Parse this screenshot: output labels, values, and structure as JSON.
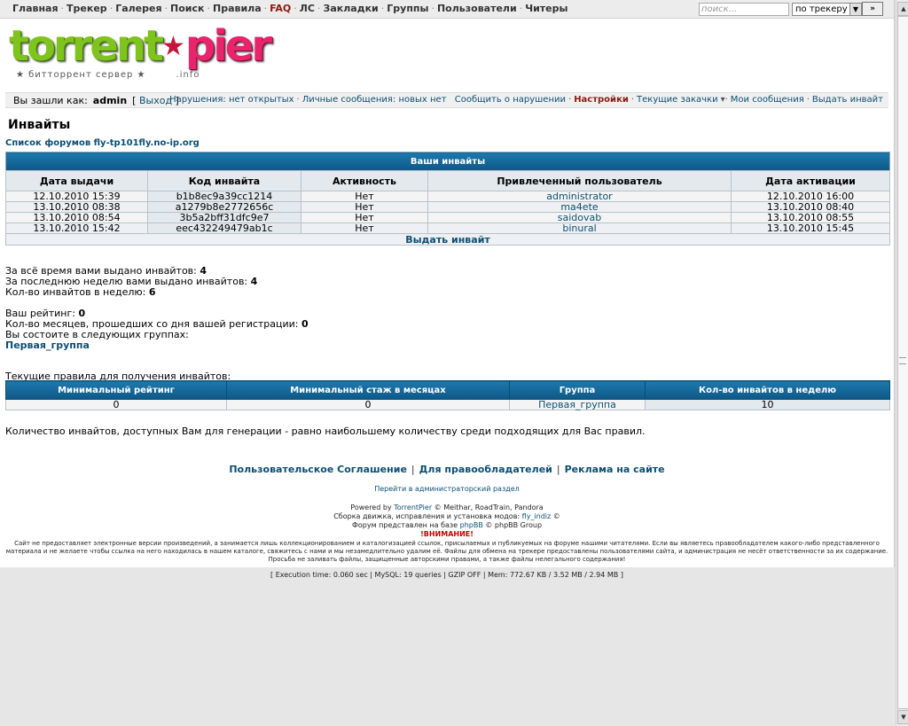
{
  "nav": {
    "items": [
      "Главная",
      "Трекер",
      "Галерея",
      "Поиск",
      "Правила",
      "FAQ",
      "ЛС",
      "Закладки",
      "Группы",
      "Пользователи",
      "Читеры"
    ],
    "search_placeholder": "поиск...",
    "search_scope": "по трекеру",
    "go_label": "»"
  },
  "logo": {
    "part1": "torrent",
    "part2": "pier",
    "tagline": "★ битторрент сервер ★",
    "domain": ".info"
  },
  "userbar": {
    "logged_as": "Вы зашли как:",
    "username": "admin",
    "logout": "Выход",
    "violations": "Нарушения: нет открытых",
    "pm": "Личные сообщения: новых нет",
    "report": "Сообщить о нарушении",
    "settings": "Настройки",
    "downloads": "Текущие закачки",
    "my_posts": "Мои сообщения",
    "give_invite": "Выдать инвайт"
  },
  "page": {
    "title": "Инвайты",
    "forum_list": "Список форумов fly-tp101fly.no-ip.org"
  },
  "invites": {
    "caption": "Ваши инвайты",
    "headers": [
      "Дата выдачи",
      "Код инвайта",
      "Активность",
      "Привлеченный пользователь",
      "Дата активации"
    ],
    "rows": [
      [
        "12.10.2010 15:39",
        "b1b8ec9a39cc1214",
        "Нет",
        "administrator",
        "12.10.2010 16:00"
      ],
      [
        "13.10.2010 08:38",
        "a1279b8e2772656c",
        "Нет",
        "ma4ete",
        "13.10.2010 08:40"
      ],
      [
        "13.10.2010 08:54",
        "3b5a2bff31dfc9e7",
        "Нет",
        "saidovab",
        "13.10.2010 08:55"
      ],
      [
        "13.10.2010 15:42",
        "eec432249479ab1c",
        "Нет",
        "binural",
        "13.10.2010 15:45"
      ]
    ],
    "give_link": "Выдать инвайт"
  },
  "stats": {
    "total_label": "За всё время вами выдано инвайтов:",
    "total": "4",
    "week_label": "За последнюю неделю вами выдано инвайтов:",
    "week": "4",
    "per_week_label": "Кол-во инвайтов в неделю:",
    "per_week": "6",
    "rating_label": "Ваш рейтинг:",
    "rating": "0",
    "months_label": "Кол-во месяцев, прошедших со дня вашей регистрации:",
    "months": "0",
    "groups_label": "Вы состоите в следующих группах:",
    "group": "Первая_группа"
  },
  "rules": {
    "title": "Текущие правила для получения инвайтов:",
    "headers": [
      "Минимальный рейтинг",
      "Минимальный стаж в месяцах",
      "Группа",
      "Кол-во инвайтов в неделю"
    ],
    "row": [
      "0",
      "0",
      "Первая_группа",
      "10"
    ],
    "note": "Количество инвайтов, доступных Вам для генерации - равно наибольшему количеству среди подходящих для Вас правил."
  },
  "footer": {
    "links": [
      "Пользовательское Соглашение",
      "Для правообладателей",
      "Реклама на сайте"
    ],
    "admin": "Перейти в администраторский раздел",
    "powered_1": "Powered by",
    "powered_tp": "TorrentPier",
    "powered_2": "© Meithar, RoadTrain, Pandora",
    "build_1": "Сборка движка, исправления и установка модов:",
    "build_author": "fly_indiz",
    "build_2": "©",
    "forum_1": "Форум представлен на базе",
    "forum_phpbb": "phpBB",
    "forum_2": "© phpBB Group",
    "warning": "!ВНИМАНИЕ!",
    "disclaimer": "Сайт не предоставляет электронные версии произведений, а занимается лишь коллекционированием и каталогизацией ссылок, присылаемых и публикуемых на форуме нашими читателями. Если вы являетесь правообладателем какого-либо представленного материала и не желаете чтобы ссылка на него находилась в нашем каталоге, свяжитесь с нами и мы незамедлительно удалим её. Файлы для обмена на трекере предоставлены пользователями сайта, и администрация не несёт ответственности за их содержание. Просьба не заливать файлы, защищенные авторскими правами, а также файлы нелегального содержания!",
    "exec": "[  Execution time: 0.060 sec  |  MySQL: 19 queries  |  GZIP OFF  |  Mem: 772.67 KB / 3.52 MB / 2.94 MB  ]"
  }
}
